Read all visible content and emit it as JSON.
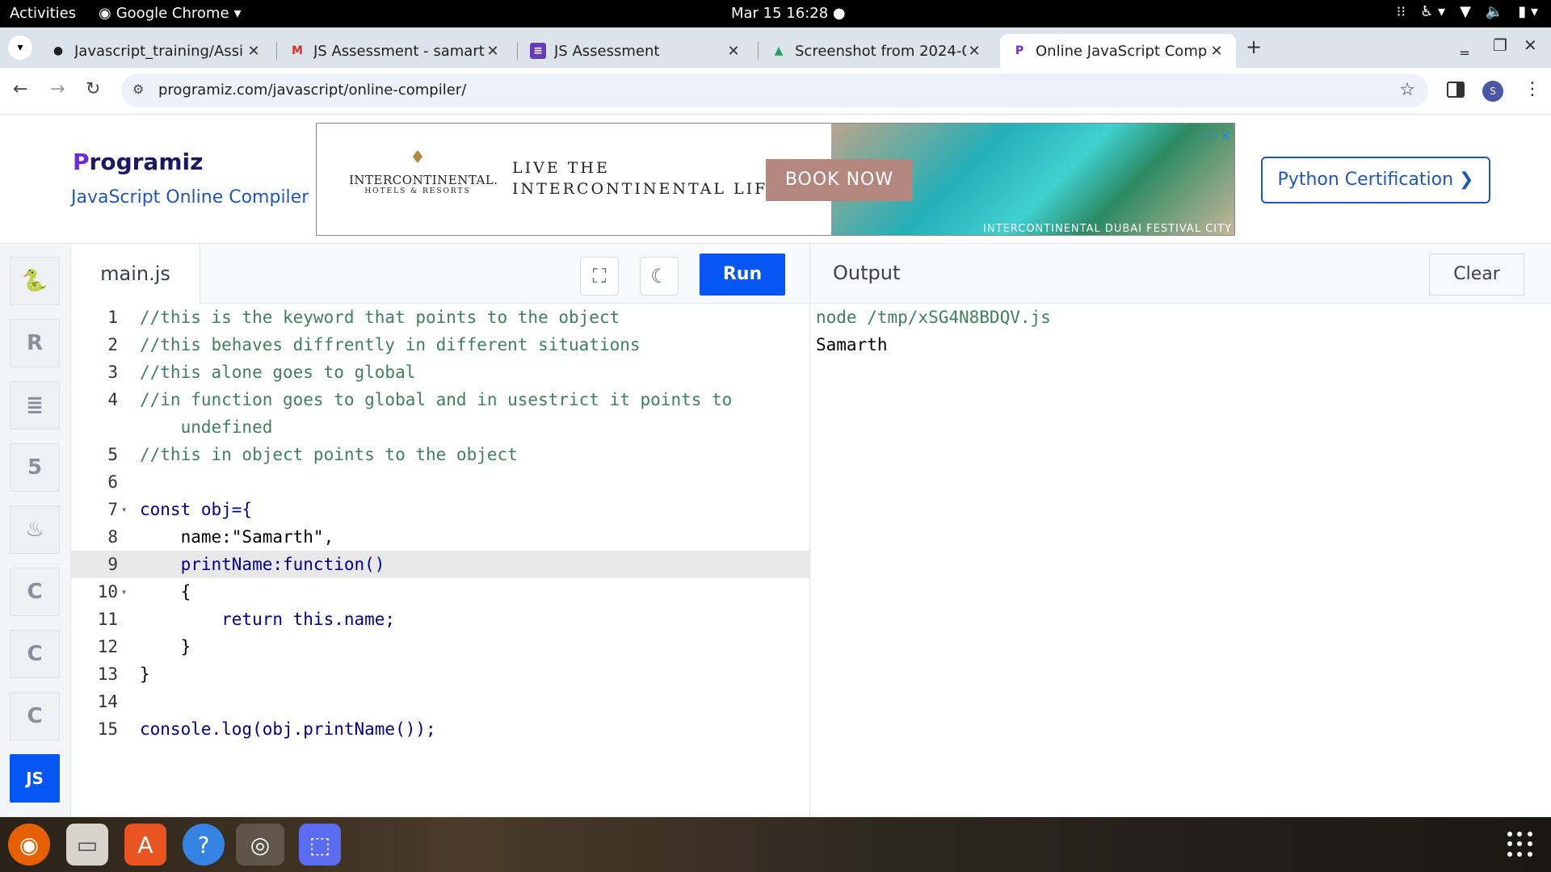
{
  "topbar": {
    "activities": "Activities",
    "app_name": "Google Chrome",
    "clock": "Mar 15  16:28"
  },
  "tabs": [
    {
      "title": "Javascript_training/Assi",
      "icon": "github-icon",
      "active": false
    },
    {
      "title": "JS Assessment - samarth",
      "icon": "gmail-icon",
      "active": false
    },
    {
      "title": "JS Assessment",
      "icon": "forms-icon",
      "active": false
    },
    {
      "title": "Screenshot from 2024-0",
      "icon": "drive-icon",
      "active": false
    },
    {
      "title": "Online JavaScript Compi",
      "icon": "programiz-icon",
      "active": true
    }
  ],
  "address_bar": {
    "url": "programiz.com/javascript/online-compiler/",
    "profile_initial": "S"
  },
  "header": {
    "logo_text": "rogramiz",
    "logo_p": "P",
    "subtitle": "JavaScript Online Compiler",
    "cta": "Python Certification ❯"
  },
  "ad": {
    "brand": "INTERCONTINENTAL.",
    "brand_sub": "HOTELS & RESORTS",
    "tagline_1": "LIVE THE",
    "tagline_2": "INTERCONTINENTAL LIFE",
    "button": "BOOK NOW",
    "caption": "INTERCONTINENTAL DUBAI FESTIVAL CITY"
  },
  "languages": [
    {
      "name": "python-lang-icon",
      "glyph": "🐍"
    },
    {
      "name": "r-lang-icon",
      "glyph": "R"
    },
    {
      "name": "sql-lang-icon",
      "glyph": "≣"
    },
    {
      "name": "html-lang-icon",
      "glyph": "5"
    },
    {
      "name": "java-lang-icon",
      "glyph": "♨"
    },
    {
      "name": "c-lang-icon",
      "glyph": "C"
    },
    {
      "name": "cpp-lang-icon",
      "glyph": "C"
    },
    {
      "name": "csharp-lang-icon",
      "glyph": "C"
    },
    {
      "name": "js-lang-icon",
      "glyph": "JS"
    }
  ],
  "editor": {
    "filename": "main.js",
    "run_label": "Run"
  },
  "code_lines": [
    {
      "n": "1",
      "text": "//this is the keyword that points to the object"
    },
    {
      "n": "2",
      "text": "//this behaves diffrently in different situations"
    },
    {
      "n": "3",
      "text": "//this alone goes to global"
    },
    {
      "n": "4",
      "text": "//in function goes to global and in usestrict it points to"
    },
    {
      "n": "",
      "text": "    undefined"
    },
    {
      "n": "5",
      "text": "//this in object points to the object"
    },
    {
      "n": "6",
      "text": ""
    },
    {
      "n": "7",
      "text": "const obj={"
    },
    {
      "n": "8",
      "text": "    name:\"Samarth\","
    },
    {
      "n": "9",
      "text": "    printName:function()"
    },
    {
      "n": "10",
      "text": "    {"
    },
    {
      "n": "11",
      "text": "        return this.name;"
    },
    {
      "n": "12",
      "text": "    }"
    },
    {
      "n": "13",
      "text": "}"
    },
    {
      "n": "14",
      "text": ""
    },
    {
      "n": "15",
      "text": "console.log(obj.printName());"
    }
  ],
  "output": {
    "title": "Output",
    "clear_label": "Clear",
    "lines": [
      "node /tmp/xSG4N8BDQV.js",
      "Samarth"
    ]
  }
}
